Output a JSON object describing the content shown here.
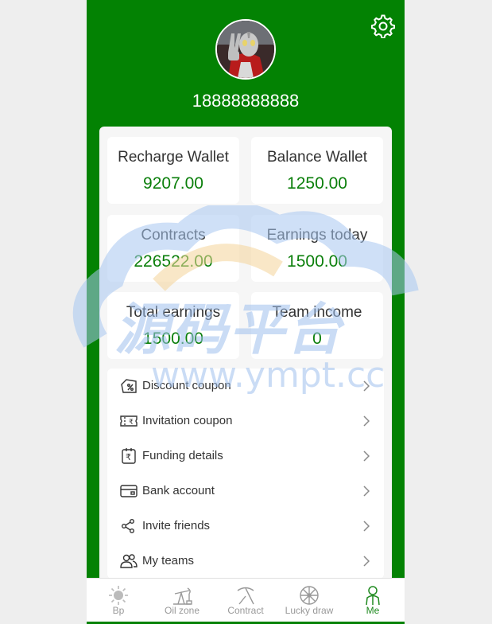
{
  "profile": {
    "phone": "18888888888"
  },
  "stats": [
    {
      "label": "Recharge Wallet",
      "value": "9207.00"
    },
    {
      "label": "Balance Wallet",
      "value": "1250.00"
    },
    {
      "label": "Contracts",
      "value": "226522.00"
    },
    {
      "label": "Earnings today",
      "value": "1500.00"
    },
    {
      "label": "Total earnings",
      "value": "1500.00"
    },
    {
      "label": "Team income",
      "value": "0"
    }
  ],
  "menu": [
    {
      "label": "Discount coupon",
      "icon": "coupon-icon"
    },
    {
      "label": "Invitation coupon",
      "icon": "ticket-icon"
    },
    {
      "label": "Funding details",
      "icon": "rupee-document-icon"
    },
    {
      "label": "Bank account",
      "icon": "card-icon"
    },
    {
      "label": "Invite friends",
      "icon": "share-icon"
    },
    {
      "label": "My teams",
      "icon": "team-icon"
    }
  ],
  "tabs": [
    {
      "label": "Bp",
      "icon": "sun-icon"
    },
    {
      "label": "Oil zone",
      "icon": "oil-pump-icon"
    },
    {
      "label": "Contract",
      "icon": "pickaxe-icon"
    },
    {
      "label": "Lucky draw",
      "icon": "wheel-icon"
    },
    {
      "label": "Me",
      "icon": "person-icon"
    }
  ],
  "watermark": {
    "text": "源码平台",
    "url": "www.ympt.cc"
  },
  "colors": {
    "header": "#038203",
    "value_text": "#0b7f0b",
    "active_tab": "#1f8a1f"
  }
}
